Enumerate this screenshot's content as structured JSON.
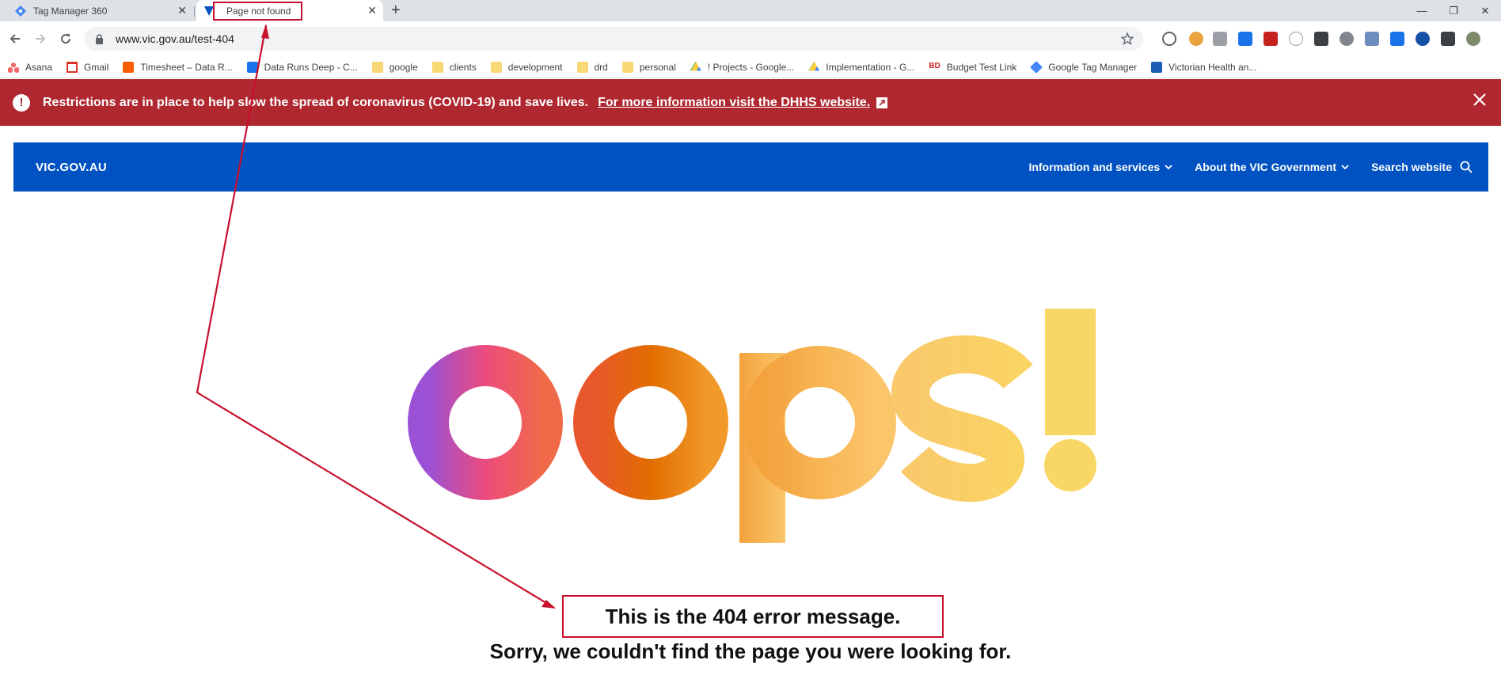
{
  "browser": {
    "tabs": [
      {
        "title": "Tag Manager 360",
        "active": false
      },
      {
        "title": "Page not found",
        "active": true
      }
    ],
    "new_tab_label": "+",
    "url": "www.vic.gov.au/test-404",
    "bookmarks": [
      {
        "label": "Asana",
        "icon": "asana-icon"
      },
      {
        "label": "Gmail",
        "icon": "gmail-icon"
      },
      {
        "label": "Timesheet – Data R...",
        "icon": "harvest-icon"
      },
      {
        "label": "Data Runs Deep - C...",
        "icon": "calendar-icon"
      },
      {
        "label": "google",
        "icon": "folder-icon"
      },
      {
        "label": "clients",
        "icon": "folder-icon"
      },
      {
        "label": "development",
        "icon": "folder-icon"
      },
      {
        "label": "drd",
        "icon": "folder-icon"
      },
      {
        "label": "personal",
        "icon": "folder-icon"
      },
      {
        "label": "! Projects - Google...",
        "icon": "google-drive-icon"
      },
      {
        "label": "Implementation - G...",
        "icon": "google-drive-icon"
      },
      {
        "label": "Budget Test Link",
        "icon": "bd-icon"
      },
      {
        "label": "Google Tag Manager",
        "icon": "gtm-icon"
      },
      {
        "label": "Victorian Health an...",
        "icon": "chart-icon"
      }
    ]
  },
  "alert": {
    "message": "Restrictions are in place to help slow the spread of coronavirus (COVID-19) and save lives.",
    "link_text": "For more information visit the DHHS website."
  },
  "header": {
    "logo": "VIC.GOV.AU",
    "nav": [
      {
        "label": "Information and services"
      },
      {
        "label": "About the VIC Government"
      }
    ],
    "search_label": "Search website"
  },
  "main": {
    "hero_text": "oops!",
    "error_message": "This is the 404 error message.",
    "sorry_message": "Sorry, we couldn't find the page you were looking for."
  },
  "colors": {
    "alert_bg": "#af272f",
    "header_bg": "#0052c2",
    "annotation": "#c8102e"
  }
}
